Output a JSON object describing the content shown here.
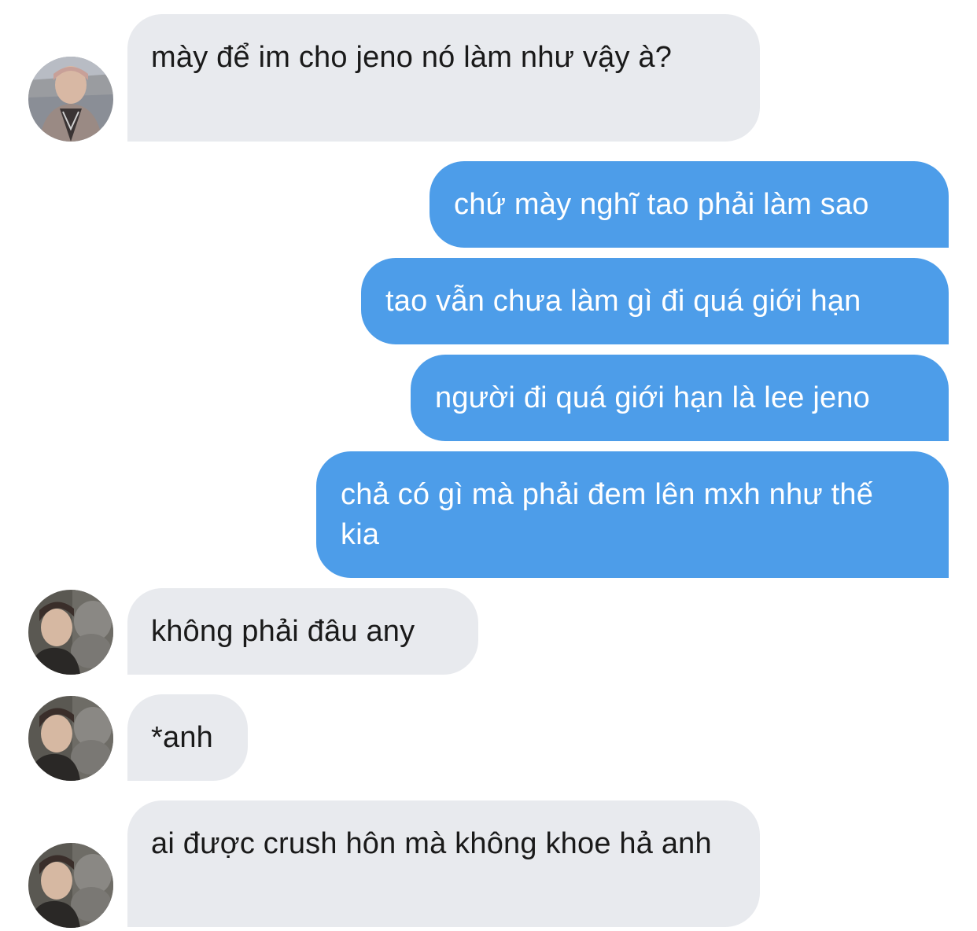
{
  "messages": [
    {
      "sender": "other",
      "avatar": "avatar-1",
      "text": "mày để im cho jeno nó làm như vậy à?"
    },
    {
      "sender": "me",
      "text": "chứ mày nghĩ tao phải làm sao"
    },
    {
      "sender": "me",
      "text": "tao vẫn chưa làm gì đi quá giới hạn"
    },
    {
      "sender": "me",
      "text": "người đi quá giới hạn là lee jeno"
    },
    {
      "sender": "me",
      "text": "chả có gì mà phải đem lên mxh như thế kia"
    },
    {
      "sender": "other",
      "avatar": "avatar-2",
      "text": "không phải đâu any"
    },
    {
      "sender": "other",
      "avatar": "avatar-2",
      "text": "*anh"
    },
    {
      "sender": "other",
      "avatar": "avatar-2",
      "text": "ai được crush hôn mà không khoe hả anh"
    }
  ],
  "colors": {
    "incoming_bubble": "#e8eaee",
    "outgoing_bubble": "#4d9de9",
    "incoming_text": "#1a1a1a",
    "outgoing_text": "#ffffff"
  }
}
